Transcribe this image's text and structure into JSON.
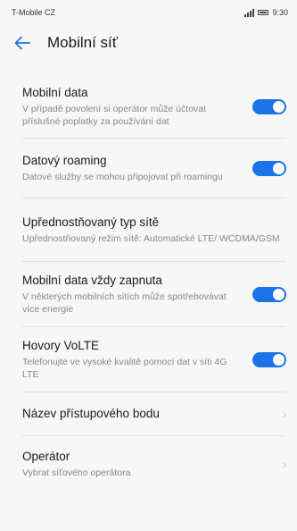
{
  "status": {
    "carrier": "T-Mobile CZ",
    "time": "9:30"
  },
  "header": {
    "title": "Mobilní síť",
    "back_icon": "arrow-left-icon",
    "accent": "#1a73e8"
  },
  "items": [
    {
      "title": "Mobilní data",
      "desc": "V případě povolení si operátor může účtovat příslušné poplatky za používání dat",
      "control": "toggle",
      "on": true
    },
    {
      "title": "Datový roaming",
      "desc": "Datové služby se mohou připojovat při roamingu",
      "control": "toggle",
      "on": true
    },
    {
      "title": "Upřednostňovaný typ sítě",
      "desc": "Upřednostňovaný režim sítě: Automatické LTE/ WCDMA/GSM",
      "control": "none"
    },
    {
      "title": "Mobilní data vždy zapnuta",
      "desc": "V některých mobilních sítích může spotřebovávat více energie",
      "control": "toggle",
      "on": true
    },
    {
      "title": "Hovory VoLTE",
      "desc": "Telefonujte ve vysoké kvalitě pomocí dat v síti 4G LTE",
      "control": "toggle",
      "on": true
    },
    {
      "title": "Název přístupového bodu",
      "control": "chevron"
    },
    {
      "title": "Operátor",
      "desc": "Vybrat síťového operátora",
      "control": "chevron"
    }
  ]
}
